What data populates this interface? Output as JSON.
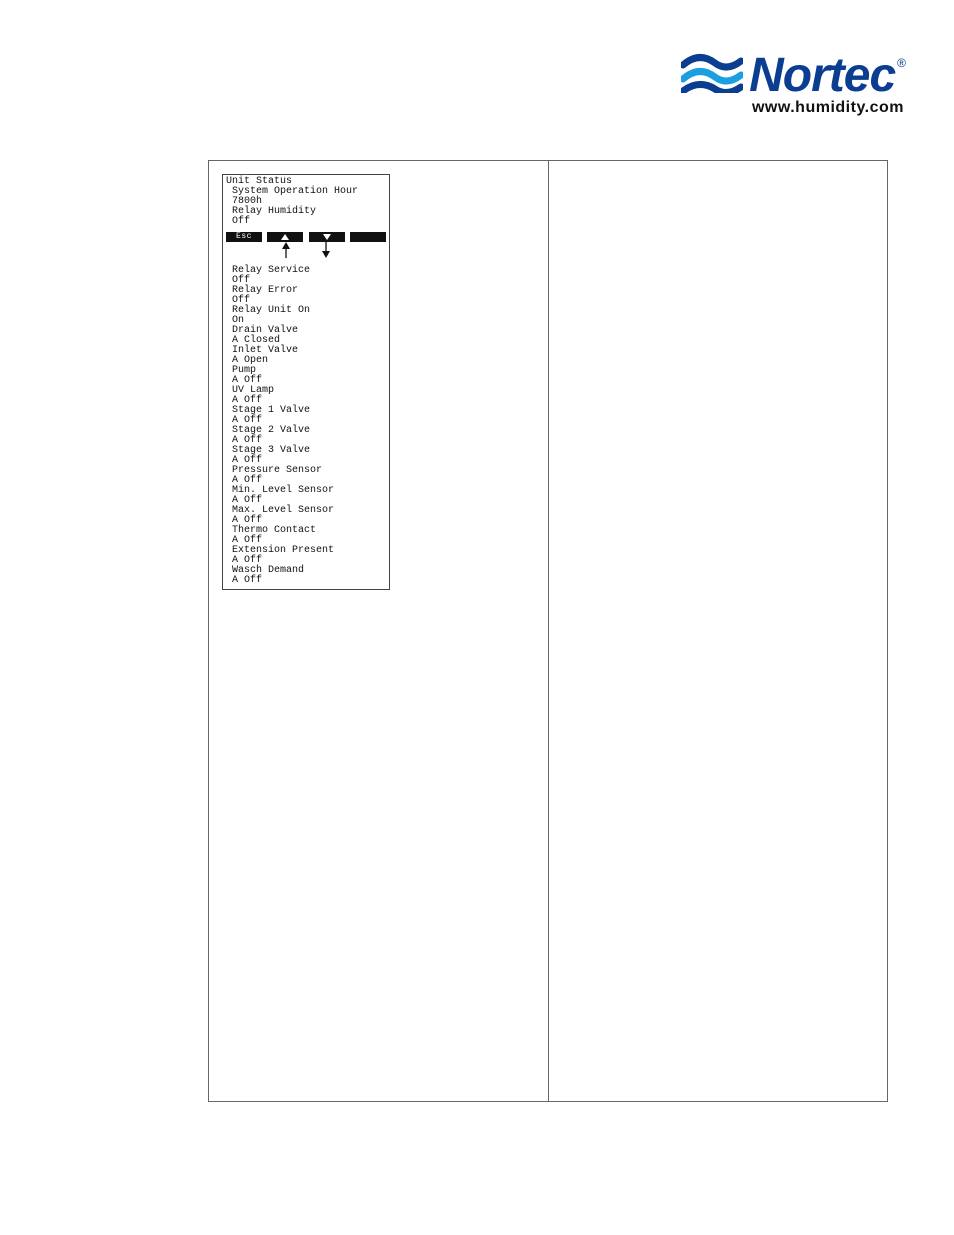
{
  "logo": {
    "brand": "Nortec",
    "registered": "®",
    "url": "www.humidity.com"
  },
  "lcd": {
    "header": [
      "Unit Status",
      " System Operation Hour",
      " 7800h",
      " Relay Humidity",
      " Off"
    ],
    "buttons": {
      "esc": "Esc"
    },
    "list": [
      " Relay Service",
      " Off",
      " Relay Error",
      " Off",
      " Relay Unit On",
      " On",
      " Drain Valve",
      " A Closed",
      " Inlet Valve",
      " A Open",
      " Pump",
      " A Off",
      " UV Lamp",
      " A Off",
      " Stage 1 Valve",
      " A Off",
      " Stage 2 Valve",
      " A Off",
      " Stage 3 Valve",
      " A Off",
      " Pressure Sensor",
      " A Off",
      " Min. Level Sensor",
      " A Off",
      " Max. Level Sensor",
      " A Off",
      " Thermo Contact",
      " A Off",
      " Extension Present",
      " A Off",
      " Wasch Demand",
      " A Off"
    ]
  }
}
